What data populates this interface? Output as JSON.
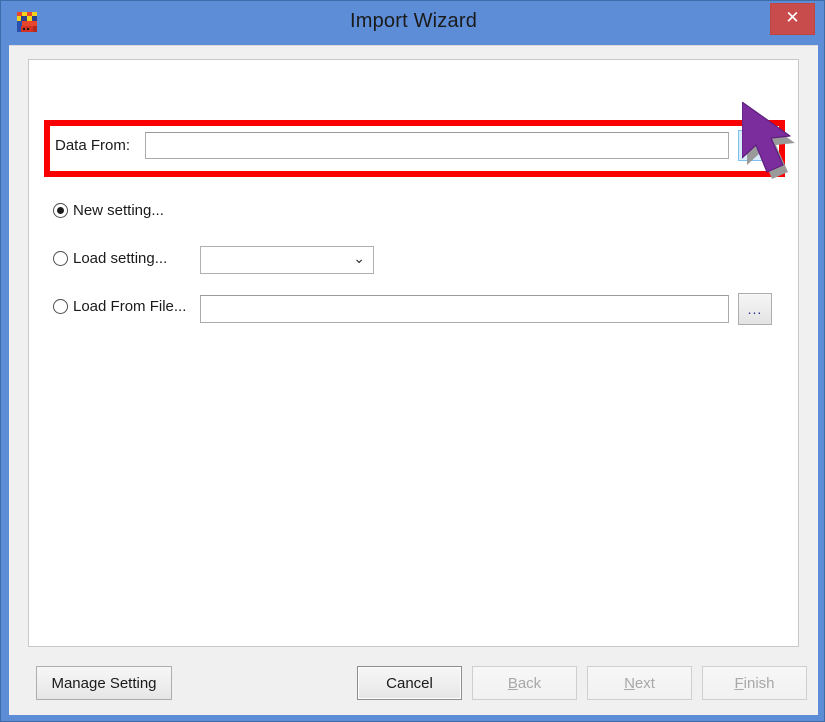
{
  "window": {
    "title": "Import Wizard",
    "icon": "app-icon",
    "close_label": "✕",
    "titlebar_color": "#5c8dd6",
    "close_button_color": "#c84c4c",
    "highlight_color": "#fb0000",
    "cursor_color": "#7b2d9e"
  },
  "form": {
    "data_from": {
      "label": "Data From:",
      "value": "",
      "placeholder": "",
      "browse_label": "..."
    },
    "options": [
      {
        "id": "new-setting",
        "label": "New setting...",
        "checked": true
      },
      {
        "id": "load-setting",
        "label": "Load setting...",
        "checked": false
      },
      {
        "id": "load-from-file",
        "label": "Load From File...",
        "checked": false
      }
    ],
    "setting_combo": {
      "value": "",
      "chevron": "⌄",
      "options": []
    },
    "load_from_file": {
      "value": "",
      "placeholder": "",
      "browse_label": "..."
    }
  },
  "footer": {
    "manage_setting": {
      "label": "Manage Setting",
      "enabled": true
    },
    "cancel": {
      "label": "Cancel",
      "enabled": true,
      "default": true
    },
    "back": {
      "accel": "B",
      "rest": "ack",
      "enabled": false
    },
    "next": {
      "accel": "N",
      "rest": "ext",
      "enabled": false
    },
    "finish": {
      "accel": "F",
      "rest": "inish",
      "enabled": false
    }
  }
}
